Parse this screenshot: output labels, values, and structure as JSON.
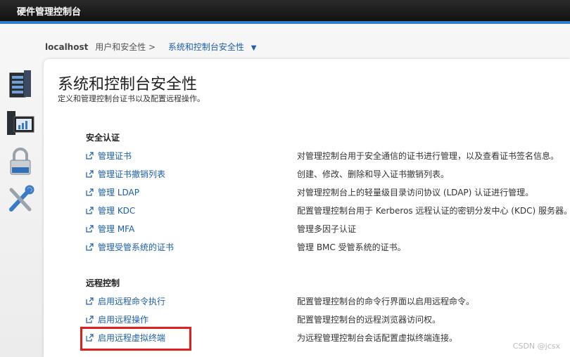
{
  "app": {
    "title": "硬件管理控制台"
  },
  "breadcrumb": {
    "host": "localhost",
    "parent": "用户和安全性 >",
    "current": "系统和控制台安全性"
  },
  "nav_icons": [
    "server-rack-icon",
    "monitor-chart-icon",
    "padlock-icon",
    "tools-icon"
  ],
  "page": {
    "title": "系统和控制台安全性",
    "subtitle": "定义和管理控制台证书以及配置远程操作。"
  },
  "sections": [
    {
      "heading": "安全认证",
      "items": [
        {
          "label": "管理证书",
          "desc": "对管理控制台用于安全通信的证书进行管理，以及查看证书签名信息。"
        },
        {
          "label": "管理证书撤销列表",
          "desc": "创建、修改、删除和导入证书撤销列表。"
        },
        {
          "label": "管理 LDAP",
          "desc": "对管理控制台上的轻量级目录访问协议 (LDAP) 认证进行管理。"
        },
        {
          "label": "管理 KDC",
          "desc": "配置管理控制台用于 Kerberos 远程认证的密钥分发中心 (KDC) 服务器。"
        },
        {
          "label": "管理 MFA",
          "desc": "管理多因子认证"
        },
        {
          "label": "管理受管系统的证书",
          "desc": "管理 BMC 受管系统的证书。"
        }
      ]
    },
    {
      "heading": "远程控制",
      "items": [
        {
          "label": "启用远程命令执行",
          "desc": "配置管理控制台的命令行界面以启用远程命令。"
        },
        {
          "label": "启用远程操作",
          "desc": "配置管理控制台的远程浏览器访问权。"
        },
        {
          "label": "启用远程虚拟终端",
          "desc": "为远程管理控制台会话配置虚拟终端连接。"
        }
      ]
    }
  ],
  "watermark": "CSDN @jcsx"
}
